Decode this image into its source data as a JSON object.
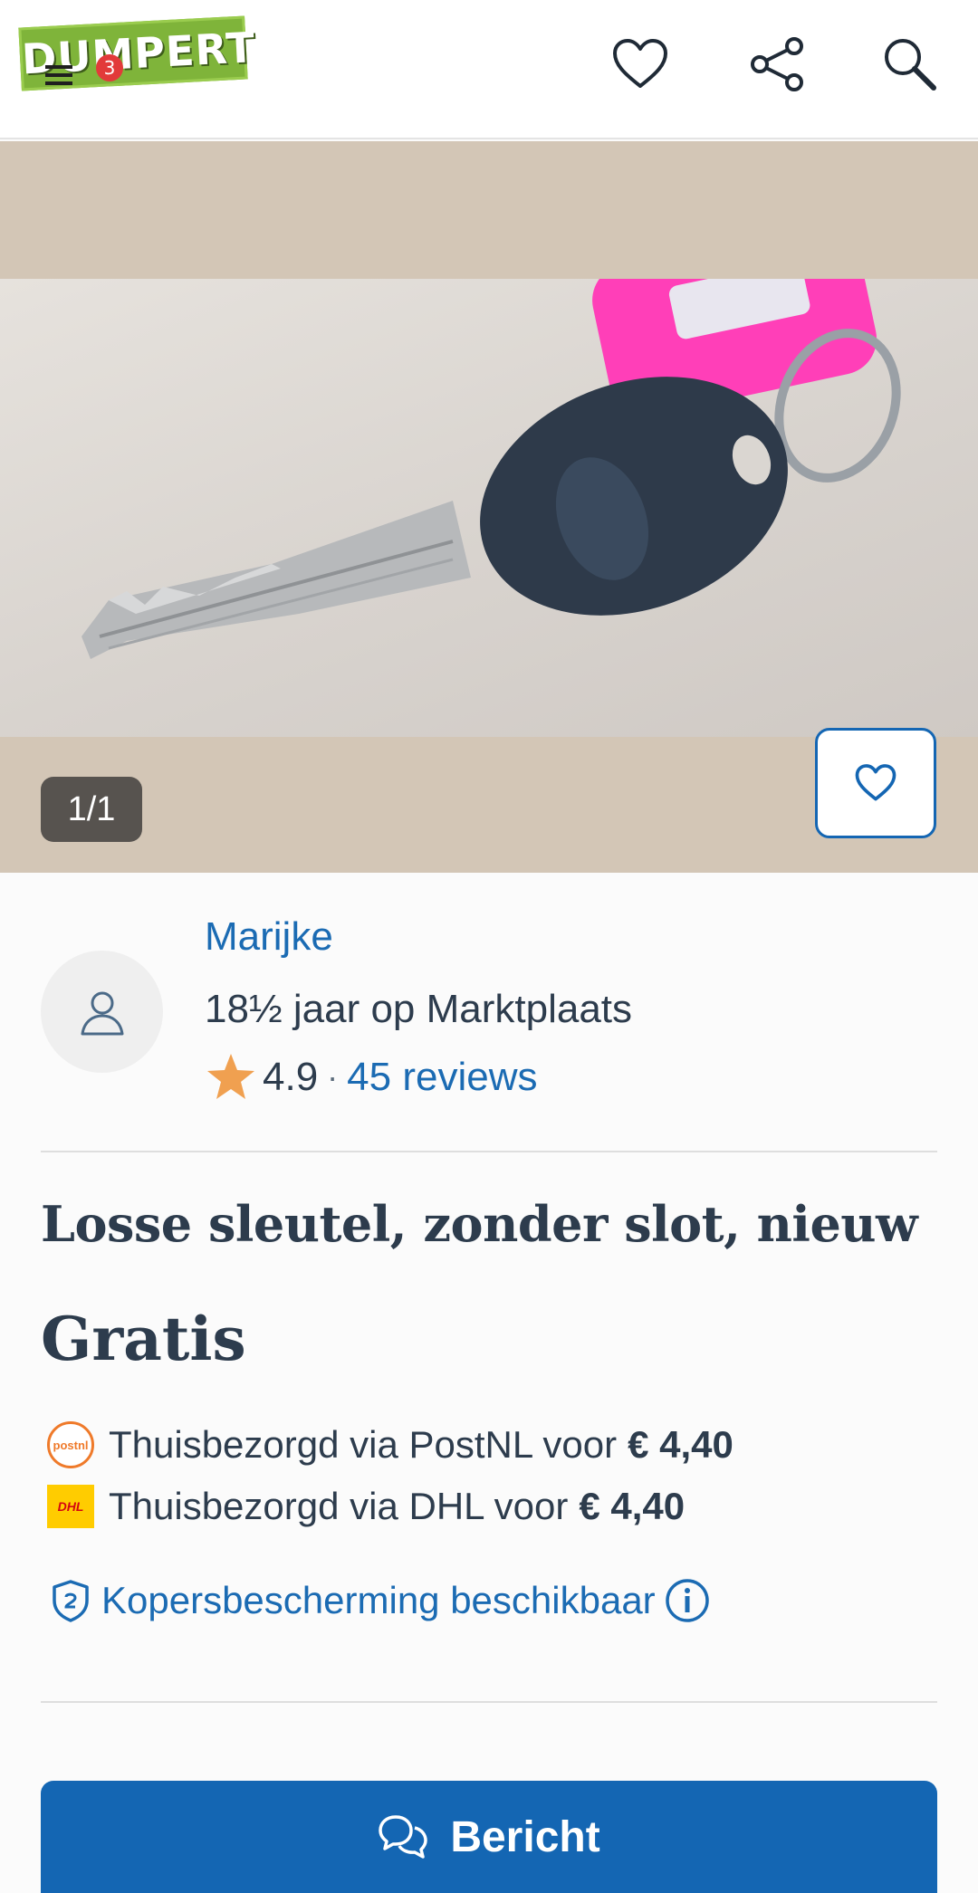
{
  "header": {
    "logo_text": "DUMPERT",
    "menu_badge": "3",
    "icons": [
      "favorite-heart-icon",
      "share-icon",
      "search-icon"
    ]
  },
  "gallery": {
    "counter": "1/1"
  },
  "seller": {
    "name": "Marijke",
    "membership": "18½ jaar op Marktplaats",
    "rating": "4.9",
    "separator": "·",
    "reviews": "45 reviews"
  },
  "listing": {
    "title": "Losse sleutel, zonder slot, nieuw",
    "price": "Gratis"
  },
  "shipping": [
    {
      "carrier_logo": "postnl",
      "label": "Thuisbezorgd via PostNL voor",
      "price": "€ 4,40"
    },
    {
      "carrier_logo": "DHL",
      "label": "Thuisbezorgd via DHL voor",
      "price": "€ 4,40"
    }
  ],
  "protection": {
    "label": "Kopersbescherming beschikbaar"
  },
  "actions": {
    "message_label": "Bericht"
  },
  "colors": {
    "accent": "#1466b3",
    "link": "#1b6bb3",
    "star": "#f0a050",
    "gallery_bg": "#d3c6b6"
  }
}
